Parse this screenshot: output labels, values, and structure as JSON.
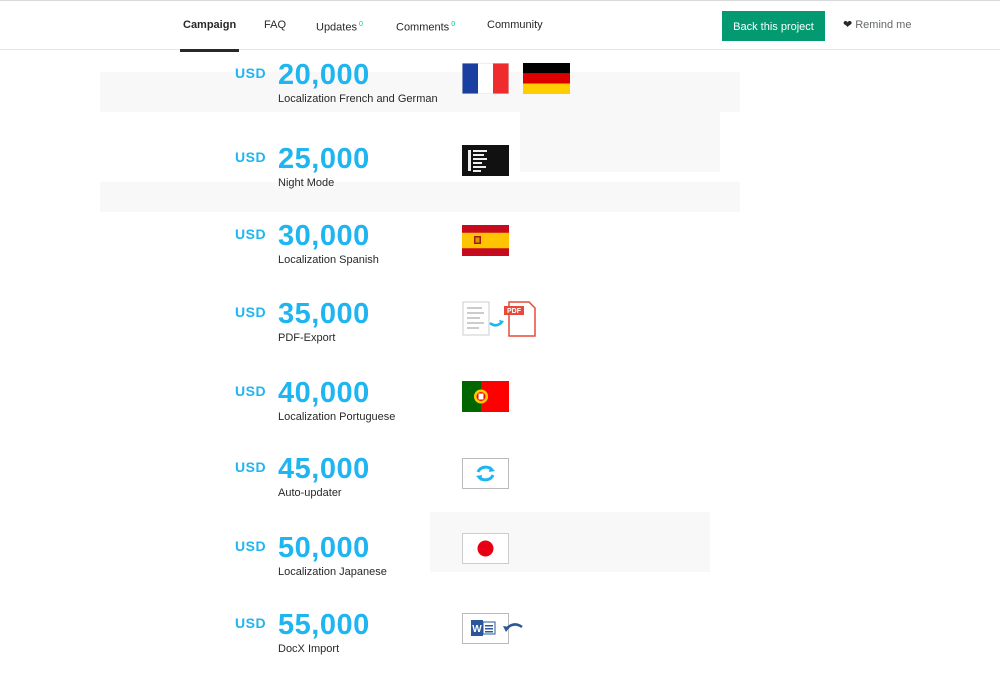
{
  "nav": {
    "tabs": [
      {
        "label": "Campaign",
        "count": ""
      },
      {
        "label": "FAQ",
        "count": ""
      },
      {
        "label": "Updates",
        "count": "0"
      },
      {
        "label": "Comments",
        "count": "0"
      },
      {
        "label": "Community",
        "count": ""
      }
    ],
    "back_label": "Back this project",
    "remind_label": "Remind me"
  },
  "colors": {
    "accent_blue": "#1fb5f0",
    "button_green": "#039a71",
    "count_green": "#05ce78"
  },
  "tiers": [
    {
      "currency": "USD",
      "amount": "20,000",
      "label": "Localization French and German",
      "icons": [
        "france-flag-icon",
        "germany-flag-icon"
      ]
    },
    {
      "currency": "USD",
      "amount": "25,000",
      "label": "Night Mode",
      "icons": [
        "night-mode-icon"
      ]
    },
    {
      "currency": "USD",
      "amount": "30,000",
      "label": "Localization Spanish",
      "icons": [
        "spain-flag-icon"
      ]
    },
    {
      "currency": "USD",
      "amount": "35,000",
      "label": "PDF-Export",
      "icons": [
        "pdf-export-icon"
      ]
    },
    {
      "currency": "USD",
      "amount": "40,000",
      "label": "Localization Portuguese",
      "icons": [
        "portugal-flag-icon"
      ]
    },
    {
      "currency": "USD",
      "amount": "45,000",
      "label": "Auto-updater",
      "icons": [
        "auto-updater-icon"
      ]
    },
    {
      "currency": "USD",
      "amount": "50,000",
      "label": "Localization Japanese",
      "icons": [
        "japan-flag-icon"
      ]
    },
    {
      "currency": "USD",
      "amount": "55,000",
      "label": "DocX Import",
      "icons": [
        "docx-import-icon"
      ]
    }
  ],
  "pdf_badge_text": "PDF",
  "docx_badge_text": "W"
}
